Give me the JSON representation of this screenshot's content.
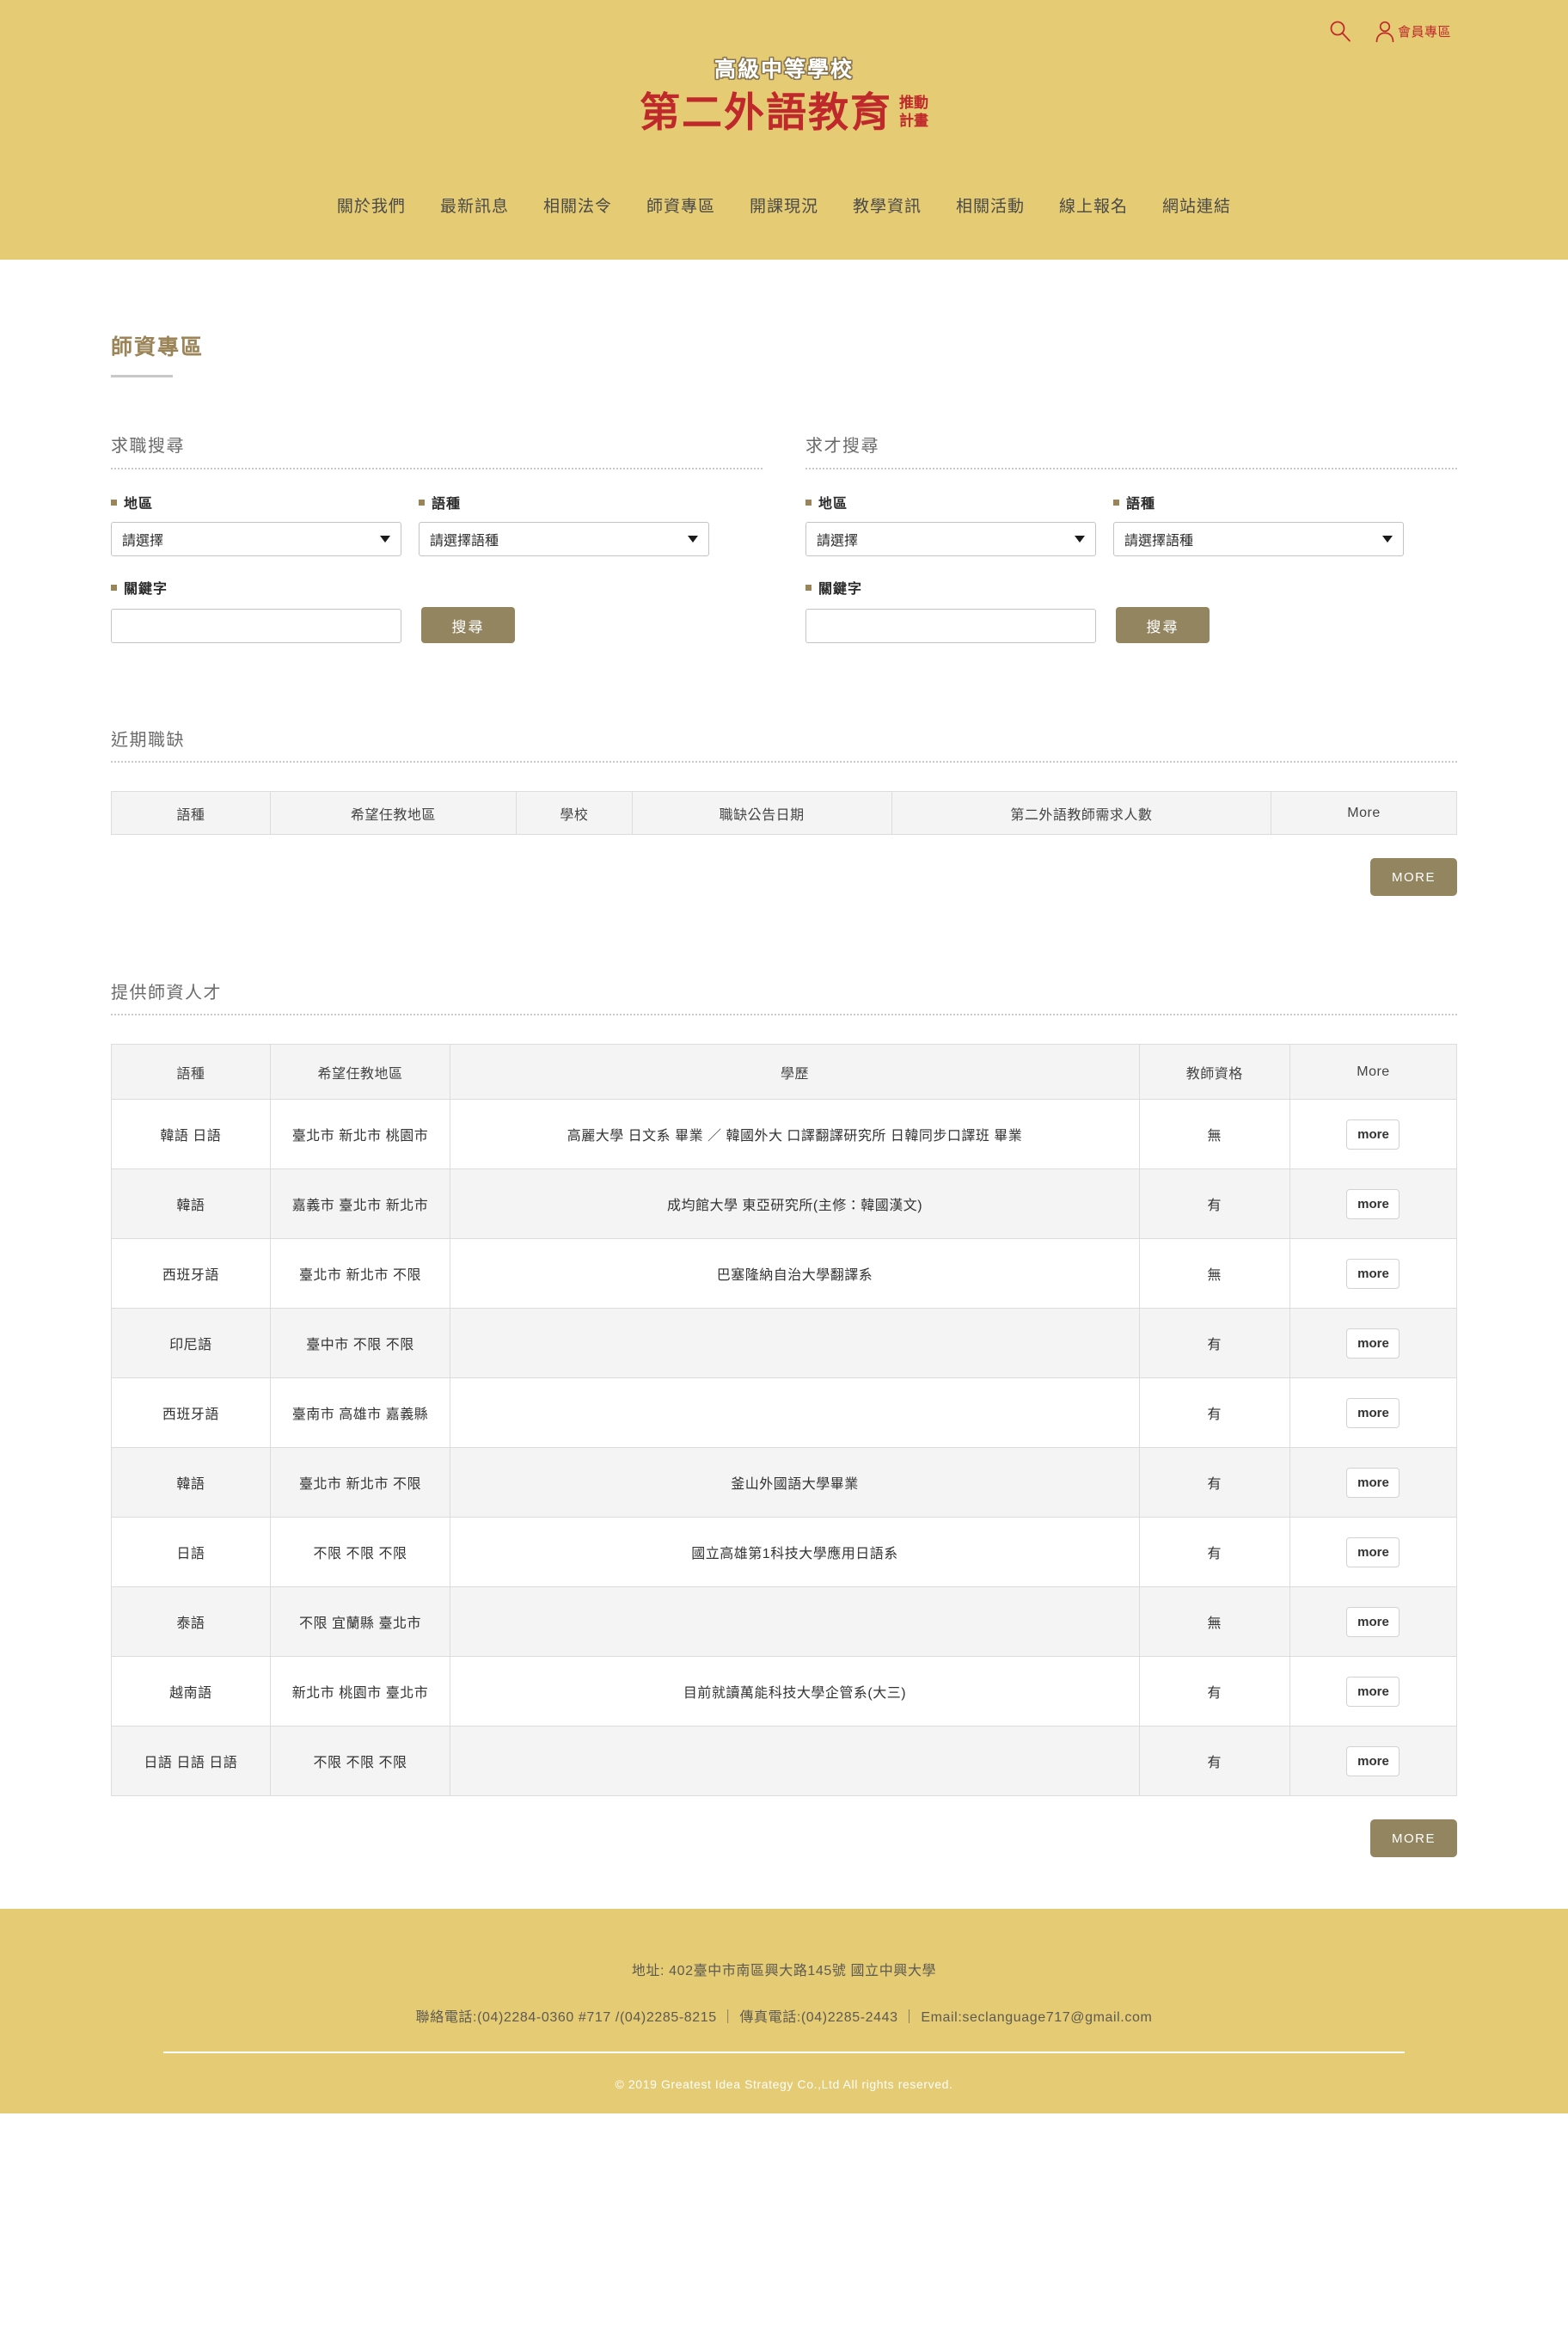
{
  "colors": {
    "header_bg": "#e4cb74",
    "brand_red": "#c0292b",
    "brown": "#938560",
    "title_brown": "#9a8458",
    "table_header_bg": "#f4f4f4"
  },
  "header": {
    "search_icon": "search-icon",
    "member_icon": "person-icon",
    "member_label": "會員專區",
    "logo_sub": "高級中等學校",
    "logo_main": "第二外語教育",
    "logo_tag_line1": "推動",
    "logo_tag_line2": "計畫",
    "nav": [
      {
        "label": "關於我們"
      },
      {
        "label": "最新訊息"
      },
      {
        "label": "相關法令"
      },
      {
        "label": "師資專區"
      },
      {
        "label": "開課現況"
      },
      {
        "label": "教學資訊"
      },
      {
        "label": "相關活動"
      },
      {
        "label": "線上報名"
      },
      {
        "label": "網站連結"
      }
    ]
  },
  "page": {
    "title": "師資專區"
  },
  "job_seek": {
    "heading": "求職搜尋",
    "region_label": "地區",
    "region_value": "請選擇",
    "language_label": "語種",
    "language_value": "請選擇語種",
    "keyword_label": "關鍵字",
    "keyword_value": "",
    "keyword_placeholder": "",
    "search_button": "搜尋"
  },
  "talent_seek": {
    "heading": "求才搜尋",
    "region_label": "地區",
    "region_value": "請選擇",
    "language_label": "語種",
    "language_value": "請選擇語種",
    "keyword_label": "關鍵字",
    "keyword_value": "",
    "keyword_placeholder": "",
    "search_button": "搜尋"
  },
  "recent_jobs": {
    "heading": "近期職缺",
    "columns": [
      "語種",
      "希望任教地區",
      "學校",
      "職缺公告日期",
      "第二外語教師需求人數",
      "More"
    ],
    "rows": [],
    "more_button": "MORE"
  },
  "talent_list": {
    "heading": "提供師資人才",
    "columns": [
      "語種",
      "希望任教地區",
      "學歷",
      "教師資格",
      "More"
    ],
    "row_button": "more",
    "rows": [
      {
        "language": "韓語 日語",
        "region": "臺北市 新北市 桃園市",
        "education": "高麗大學 日文系 畢業 ／ 韓國外大 口譯翻譯研究所 日韓同步口譯班 畢業",
        "cert": "無"
      },
      {
        "language": "韓語",
        "region": "嘉義市 臺北市 新北市",
        "education": "成均館大學 東亞研究所(主修：韓國漢文)",
        "cert": "有"
      },
      {
        "language": "西班牙語",
        "region": "臺北市 新北市 不限",
        "education": "巴塞隆納自治大學翻譯系",
        "cert": "無"
      },
      {
        "language": "印尼語",
        "region": "臺中市 不限 不限",
        "education": "",
        "cert": "有"
      },
      {
        "language": "西班牙語",
        "region": "臺南市 高雄市 嘉義縣",
        "education": "",
        "cert": "有"
      },
      {
        "language": "韓語",
        "region": "臺北市 新北市 不限",
        "education": "釜山外國語大學畢業",
        "cert": "有"
      },
      {
        "language": "日語",
        "region": "不限 不限 不限",
        "education": "國立高雄第1科技大學應用日語系",
        "cert": "有"
      },
      {
        "language": "泰語",
        "region": "不限 宜蘭縣 臺北市",
        "education": "",
        "cert": "無"
      },
      {
        "language": "越南語",
        "region": "新北市 桃園市 臺北市",
        "education": "目前就讀萬能科技大學企管系(大三)",
        "cert": "有"
      },
      {
        "language": "日語 日語 日語",
        "region": "不限 不限 不限",
        "education": "",
        "cert": "有"
      }
    ],
    "more_button": "MORE"
  },
  "footer": {
    "address": "地址: 402臺中市南區興大路145號 國立中興大學",
    "contact": "聯絡電話:(04)2284-0360 #717 /(04)2285-8215 ｜ 傳真電話:(04)2285-2443 ｜ Email:seclanguage717@gmail.com",
    "copyright": "© 2019 Greatest Idea Strategy Co.,Ltd All rights reserved."
  }
}
